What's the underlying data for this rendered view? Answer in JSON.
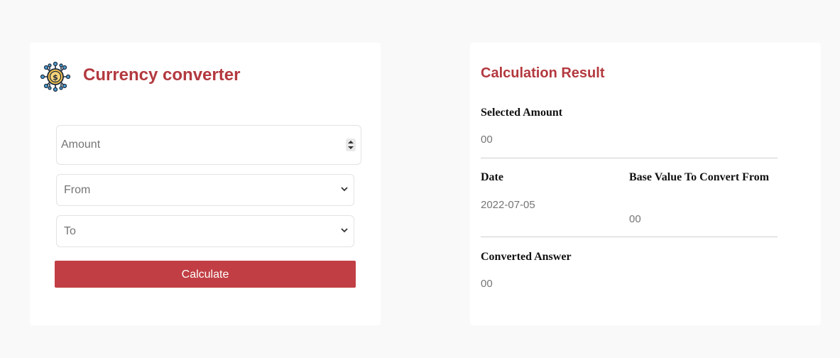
{
  "converter": {
    "title": "Currency converter",
    "logo_icon": "currency-network-icon",
    "amount_placeholder": "Amount",
    "from_placeholder": "From",
    "to_placeholder": "To",
    "calculate_label": "Calculate"
  },
  "result": {
    "title": "Calculation Result",
    "selected_amount_label": "Selected Amount",
    "selected_amount_value": "00",
    "date_label": "Date",
    "date_value": "2022-07-05",
    "base_value_label": "Base Value To Convert From",
    "base_value_value": "00",
    "converted_label": "Converted Answer",
    "converted_value": "00"
  },
  "colors": {
    "accent": "#b3393f",
    "button": "#c13f44",
    "background": "#f9f9f9"
  }
}
